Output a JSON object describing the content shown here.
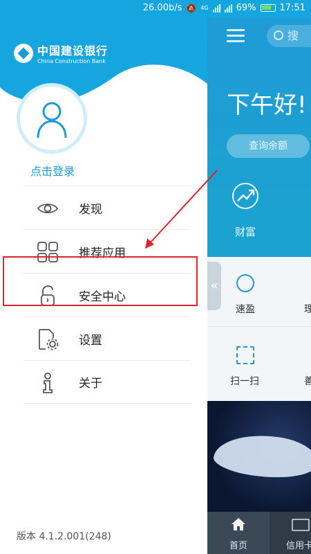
{
  "status_bar": {
    "speed": "26.00b/s",
    "network": "4G",
    "battery": "69%",
    "time": "17:51"
  },
  "bank": {
    "name_cn": "中国建设银行",
    "name_en": "China Construction Bank"
  },
  "drawer": {
    "login": "点击登录",
    "menu": [
      {
        "label": "发现",
        "icon": "eye-icon"
      },
      {
        "label": "推荐应用",
        "icon": "apps-grid-icon"
      },
      {
        "label": "安全中心",
        "icon": "lock-icon"
      },
      {
        "label": "设置",
        "icon": "settings-doc-icon"
      },
      {
        "label": "关于",
        "icon": "info-icon"
      }
    ],
    "version": "版本 4.1.2.001(248)"
  },
  "background": {
    "search": "搜",
    "greeting": "下午好!",
    "balance_button": "查询余额",
    "wealth": "财富",
    "quick": [
      "速盈",
      "理",
      "扫一扫",
      "善"
    ],
    "nav": {
      "home": "首页",
      "credit": "信用卡"
    }
  },
  "colors": {
    "brand_blue": "#1a9ad6",
    "highlight_red": "#e0222b"
  }
}
